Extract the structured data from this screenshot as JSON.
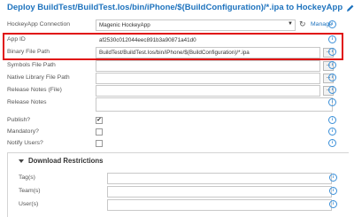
{
  "title": "Deploy BuildTest/BuildTest.Ios/bin/iPhone/$(BuildConfiguration)/*.ipa to HockeyApp",
  "connection": {
    "label": "HockeyApp Connection",
    "value": "Magenic HockeyApp",
    "manage": "Manage"
  },
  "app_id": {
    "label": "App ID",
    "value": "af2530c012044eec891b3a90871a41d0"
  },
  "binary": {
    "label": "Binary File Path",
    "value": "BuildTest/BuildTest.Ios/bin/iPhone/$(BuildConfiguration)/*.ipa"
  },
  "symbols": {
    "label": "Symbols File Path",
    "value": ""
  },
  "native_lib": {
    "label": "Native Library File Path",
    "value": ""
  },
  "release_notes_file": {
    "label": "Release Notes (File)",
    "value": ""
  },
  "release_notes": {
    "label": "Release Notes",
    "value": ""
  },
  "publish": {
    "label": "Publish?",
    "checked": true
  },
  "mandatory": {
    "label": "Mandatory?",
    "checked": false
  },
  "notify": {
    "label": "Notify Users?",
    "checked": false
  },
  "download": {
    "title": "Download Restrictions",
    "tags": {
      "label": "Tag(s)",
      "value": ""
    },
    "teams": {
      "label": "Team(s)",
      "value": ""
    },
    "users": {
      "label": "User(s)",
      "value": ""
    }
  },
  "icons": {
    "info": "info-icon",
    "browse": "ellipsis-icon",
    "refresh": "refresh-icon",
    "edit": "pencil-icon"
  },
  "colors": {
    "accent": "#1e73be",
    "highlight": "#e01010"
  }
}
